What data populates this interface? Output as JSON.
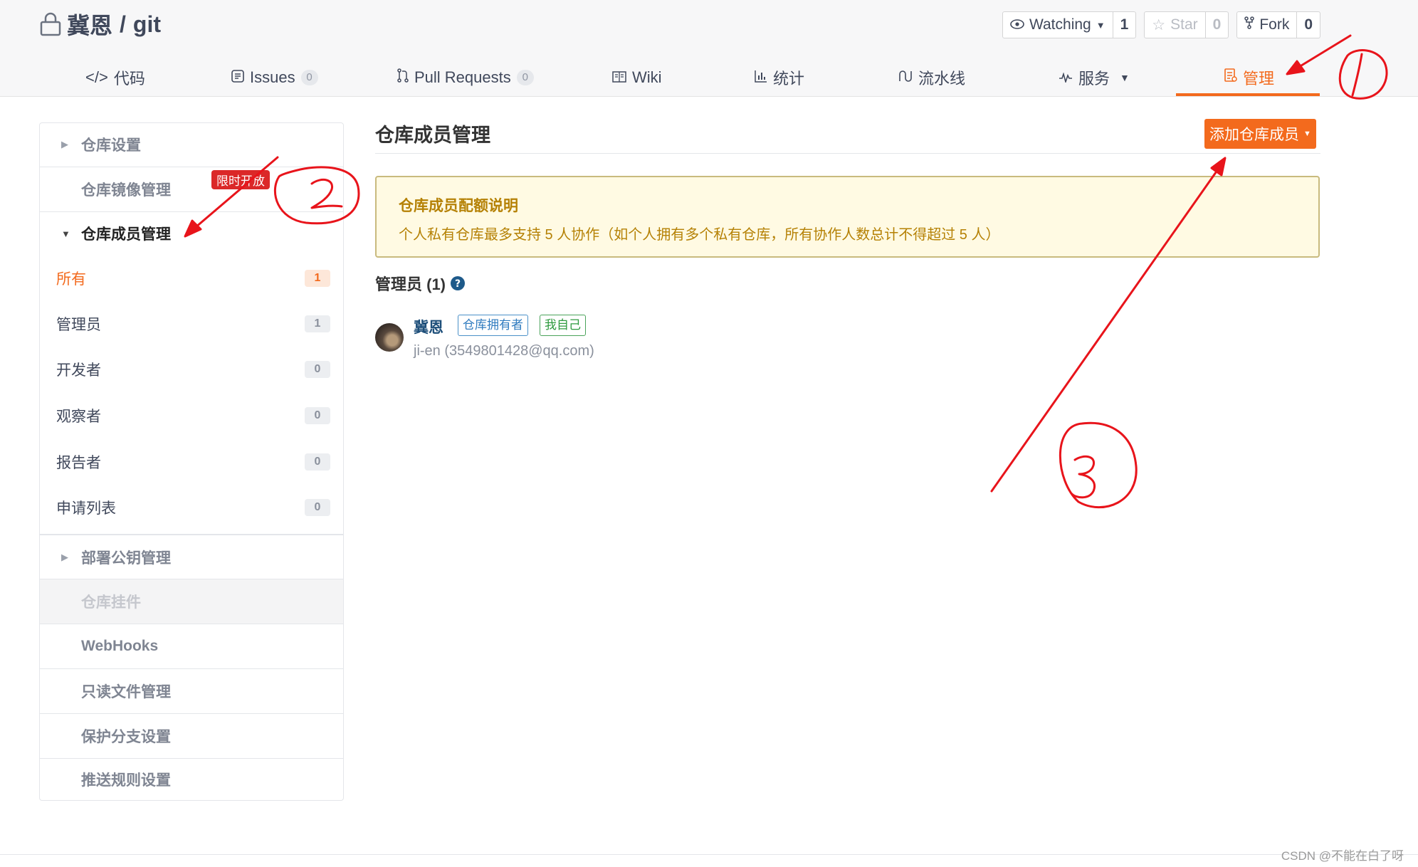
{
  "header": {
    "owner": "冀恩",
    "separator": "/",
    "repo_name": "git",
    "actions": {
      "watch_label": "Watching",
      "watch_count": "1",
      "star_label": "Star",
      "star_count": "0",
      "fork_label": "Fork",
      "fork_count": "0"
    }
  },
  "tabs": [
    {
      "label": "代码",
      "icon": "code-icon"
    },
    {
      "label": "Issues",
      "icon": "issues-icon",
      "count": "0"
    },
    {
      "label": "Pull Requests",
      "icon": "pull-request-icon",
      "count": "0"
    },
    {
      "label": "Wiki",
      "icon": "wiki-icon"
    },
    {
      "label": "统计",
      "icon": "stats-icon"
    },
    {
      "label": "流水线",
      "icon": "pipeline-icon"
    },
    {
      "label": "服务",
      "icon": "service-icon"
    },
    {
      "label": "管理",
      "icon": "manage-icon",
      "active": true
    }
  ],
  "sidebar": {
    "repo_settings": "仓库设置",
    "mirror_management": "仓库镜像管理",
    "limited_badge": "限时开放",
    "member_management": "仓库成员管理",
    "member_filters": [
      {
        "label": "所有",
        "count": "1",
        "active": true
      },
      {
        "label": "管理员",
        "count": "1"
      },
      {
        "label": "开发者",
        "count": "0"
      },
      {
        "label": "观察者",
        "count": "0"
      },
      {
        "label": "报告者",
        "count": "0"
      },
      {
        "label": "申请列表",
        "count": "0"
      }
    ],
    "deploy_keys": "部署公钥管理",
    "repo_widgets": "仓库挂件",
    "webhooks": "WebHooks",
    "readonly_files": "只读文件管理",
    "protected_branches": "保护分支设置",
    "push_rules": "推送规则设置"
  },
  "main": {
    "title": "仓库成员管理",
    "add_button": "添加仓库成员",
    "notice_title": "仓库成员配额说明",
    "notice_body": "个人私有仓库最多支持 5 人协作（如个人拥有多个私有仓库，所有协作人数总计不得超过 5 人）",
    "admin_heading": "管理员 (1)",
    "members": [
      {
        "name": "冀恩",
        "tag_owner": "仓库拥有者",
        "tag_self": "我自己",
        "handle": "ji-en (3549801428@qq.com)"
      }
    ]
  },
  "annotations": [
    "1",
    "2",
    "3"
  ],
  "watermark": "CSDN @不能在白了呀",
  "colors": {
    "accent": "#f36a1d",
    "notice_bg": "#fffae3",
    "notice_text": "#b58105",
    "annotation_red": "#e8141b"
  }
}
